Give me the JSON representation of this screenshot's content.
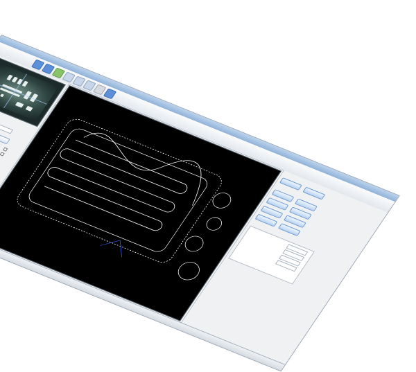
{
  "app": {
    "title": "",
    "toolbar": [
      {
        "label": "",
        "icon": "open-file-icon",
        "color": "#5d8fd6"
      },
      {
        "label": "",
        "icon": "save-icon",
        "color": "#5d8fd6"
      },
      {
        "label": "",
        "icon": "camera-icon",
        "color": "#8ac46a"
      },
      {
        "label": "",
        "icon": "layers-icon",
        "color": "#c7d6e8"
      },
      {
        "label": "",
        "icon": "grid-icon",
        "color": "#c7d6e8"
      },
      {
        "label": "",
        "icon": "fiducial-icon",
        "color": "#c7d6e8"
      },
      {
        "label": "",
        "icon": "settings-icon",
        "color": "#d6d9de"
      },
      {
        "label": "",
        "icon": "export-icon",
        "color": "#5d8fd6"
      }
    ]
  },
  "colors": {
    "canvas_background": "#000000",
    "path_stroke": "#ffffff",
    "accent_button": "#b9d3f1",
    "titlebar": "#8fb1d8"
  },
  "status": {
    "text": ""
  }
}
